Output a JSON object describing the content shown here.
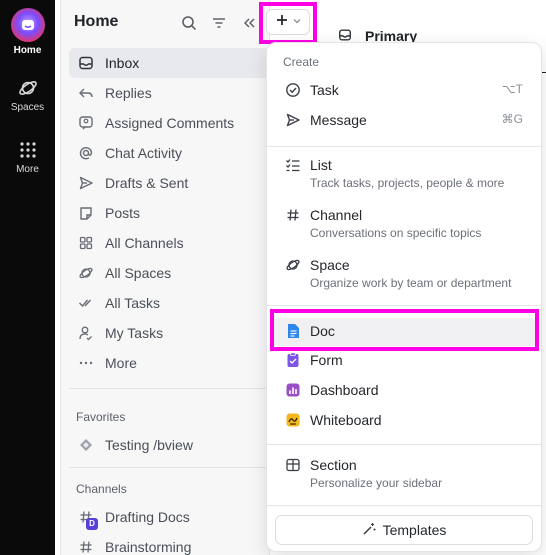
{
  "rail": {
    "items": [
      {
        "label": "Home",
        "icon": "home-logo-icon"
      },
      {
        "label": "Spaces",
        "icon": "planet-icon"
      },
      {
        "label": "More",
        "icon": "grid-dots-icon"
      }
    ]
  },
  "sidebar": {
    "title": "Home",
    "nav": [
      {
        "label": "Inbox",
        "icon": "inbox-icon"
      },
      {
        "label": "Replies",
        "icon": "reply-icon"
      },
      {
        "label": "Assigned Comments",
        "icon": "comment-assigned-icon"
      },
      {
        "label": "Chat Activity",
        "icon": "at-icon"
      },
      {
        "label": "Drafts & Sent",
        "icon": "send-icon"
      },
      {
        "label": "Posts",
        "icon": "post-icon"
      },
      {
        "label": "All Channels",
        "icon": "channels-icon"
      },
      {
        "label": "All Spaces",
        "icon": "planet-icon"
      },
      {
        "label": "All Tasks",
        "icon": "double-check-icon"
      },
      {
        "label": "My Tasks",
        "icon": "user-task-icon"
      },
      {
        "label": "More",
        "icon": "ellipsis-icon"
      }
    ],
    "favorites": {
      "title": "Favorites",
      "items": [
        {
          "label": "Testing /bview"
        }
      ]
    },
    "channels": {
      "title": "Channels",
      "items": [
        {
          "label": "Drafting Docs",
          "badge": "D"
        },
        {
          "label": "Brainstorming"
        }
      ]
    }
  },
  "main": {
    "title": "Primary"
  },
  "menu": {
    "header": "Create",
    "items": {
      "task": {
        "label": "Task",
        "shortcut": "⌥T"
      },
      "message": {
        "label": "Message",
        "shortcut": "⌘G"
      },
      "list": {
        "label": "List",
        "sub": "Track tasks, projects, people & more"
      },
      "channel": {
        "label": "Channel",
        "sub": "Conversations on specific topics"
      },
      "space": {
        "label": "Space",
        "sub": "Organize work by team or department"
      },
      "doc": {
        "label": "Doc"
      },
      "form": {
        "label": "Form"
      },
      "dashboard": {
        "label": "Dashboard"
      },
      "whiteboard": {
        "label": "Whiteboard"
      },
      "section": {
        "label": "Section",
        "sub": "Personalize your sidebar"
      }
    },
    "templates_label": "Templates"
  },
  "colors": {
    "highlight": "#ff00e6",
    "doc": "#2f86eb",
    "form": "#7b55e8",
    "dashboard": "#9b4fc6",
    "whiteboard": "#f4b81c",
    "badge": "#5a3fd8"
  }
}
